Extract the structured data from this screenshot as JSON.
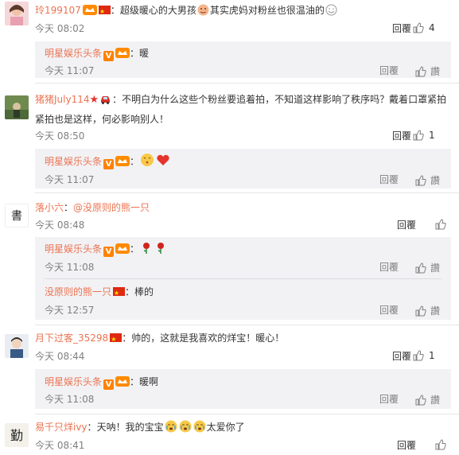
{
  "actions": {
    "reply_label": "回覆"
  },
  "comments": [
    {
      "user": "玲199107",
      "sep": "：",
      "text_a": "超级暖心的大男孩",
      "text_b": "其实虎妈对粉丝也很温油的",
      "time": "今天 08:02",
      "likes": "4",
      "icons": [
        "crown-badge-icon",
        "china-flag-icon",
        "face-emoji-icon",
        "face-emoji-icon"
      ],
      "reply": {
        "user": "明星娱乐头条",
        "sep": "：",
        "text": "暖",
        "time": "今天 11:07"
      }
    },
    {
      "user": "猪猪July114",
      "sep": "：",
      "text": "不明白为什么这些个粉丝要追着拍，不知道这样影响了秩序吗？戴着口罩紧拍紧拍也是这样，何必影响别人！",
      "time": "今天 08:50",
      "likes": "1",
      "icons": [
        "star-icon",
        "car-icon"
      ],
      "reply": {
        "user": "明星娱乐头条",
        "sep": "：",
        "text": "",
        "time": "今天 11:07"
      }
    },
    {
      "user": "落小六",
      "sep": "：",
      "text": "@没原则的熊一只",
      "time": "今天 08:48",
      "likes": "",
      "replies": [
        {
          "user": "明星娱乐头条",
          "sep": "：",
          "text": "",
          "time": "今天 11:08"
        },
        {
          "user": "没原则的熊一只",
          "sep": "：",
          "text": "棒的",
          "time": "今天 12:57"
        }
      ]
    },
    {
      "user": "月下过客_35298",
      "sep": "：",
      "text": "帅的，这就是我喜欢的烊宝！暖心！",
      "time": "今天 08:44",
      "likes": "1",
      "reply": {
        "user": "明星娱乐头条",
        "sep": "：",
        "text": "暖啊",
        "time": "今天 11:08"
      }
    },
    {
      "user": "易千只烊ivy",
      "sep": "：",
      "text_a": "天呐！我的宝宝",
      "text_b": "太爱你了",
      "time": "今天 08:41",
      "likes": ""
    }
  ],
  "colors": {
    "link": "#eb7350",
    "muted": "#808080",
    "reply_bg": "#f2f2f5"
  }
}
